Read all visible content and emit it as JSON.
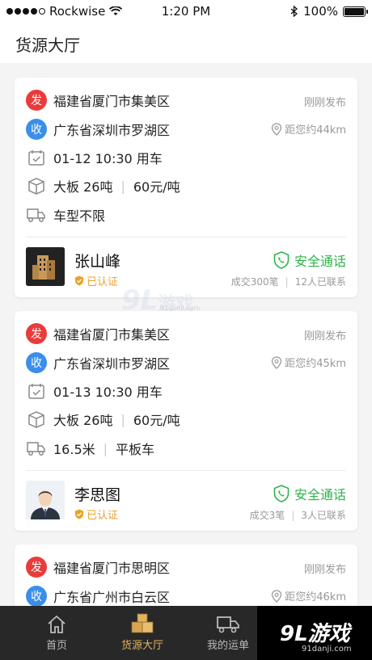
{
  "status_bar": {
    "carrier": "Rockwise",
    "time": "1:20 PM",
    "battery": "100%",
    "signal_bars": 4
  },
  "page_title": "货源大厅",
  "cards": [
    {
      "origin_badge": "发",
      "origin": "福建省厦门市集美区",
      "posted": "刚刚发布",
      "dest_badge": "收",
      "destination": "广东省深圳市罗湖区",
      "distance": "距您约44km",
      "date": "01-12 10:30 用车",
      "cargo_type": "大板 26吨",
      "price": "60元/吨",
      "truck": "车型不限",
      "truck2": "",
      "user_name": "张山峰",
      "verified": "已认证",
      "call": "安全通话",
      "deals": "成交300笔",
      "contacted": "12人已联系"
    },
    {
      "origin_badge": "发",
      "origin": "福建省厦门市集美区",
      "posted": "刚刚发布",
      "dest_badge": "收",
      "destination": "广东省深圳市罗湖区",
      "distance": "距您约45km",
      "date": "01-13 10:30 用车",
      "cargo_type": "大板 26吨",
      "price": "60元/吨",
      "truck": "16.5米",
      "truck2": "平板车",
      "user_name": "李思图",
      "verified": "已认证",
      "call": "安全通话",
      "deals": "成交3笔",
      "contacted": "3人已联系"
    },
    {
      "origin_badge": "发",
      "origin": "福建省厦门市思明区",
      "posted": "刚刚发布",
      "dest_badge": "收",
      "destination": "广东省广州市白云区",
      "distance": "距您约46km"
    }
  ],
  "watermark": {
    "num": "9L",
    "text": "游戏",
    "sub": "91danji.com"
  },
  "tabs": [
    {
      "label": "首页",
      "icon": "home-icon"
    },
    {
      "label": "货源大厅",
      "icon": "boxes-icon",
      "active": true
    },
    {
      "label": "我的运单",
      "icon": "truck-icon"
    }
  ],
  "brand": {
    "logo": "9L游戏",
    "url": "91danji.com"
  },
  "colors": {
    "accent": "#e3b35f",
    "green": "#2fb34a",
    "red": "#ea3b3b",
    "blue": "#3b8eea",
    "tabbar": "#282828"
  }
}
